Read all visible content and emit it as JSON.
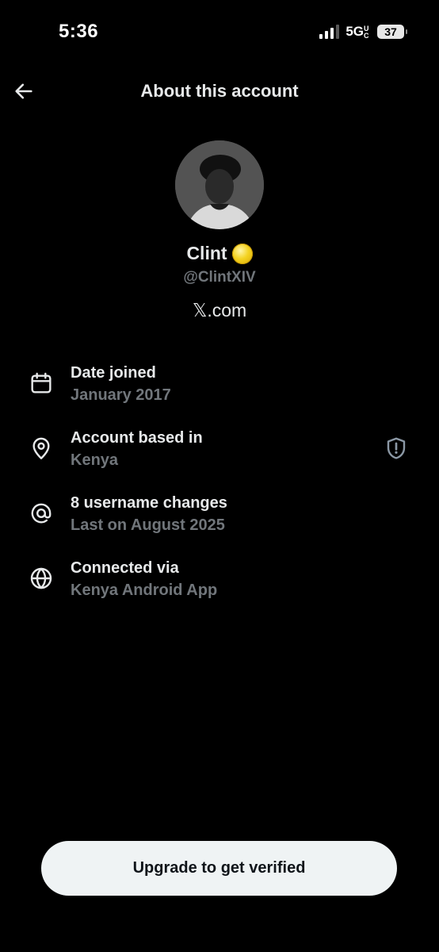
{
  "status_bar": {
    "time": "5:36",
    "network": "5G",
    "network_suffix": "UC",
    "battery": "37"
  },
  "header": {
    "title": "About this account"
  },
  "profile": {
    "name": "Clint",
    "handle": "@ClintXIV",
    "platform": "𝕏.com"
  },
  "info": {
    "date_joined": {
      "title": "Date joined",
      "value": "January 2017",
      "icon": "calendar-icon"
    },
    "location": {
      "title": "Account based in",
      "value": "Kenya",
      "icon": "location-pin-icon",
      "action_icon": "shield-alert-icon"
    },
    "username": {
      "title": "8 username changes",
      "value": "Last on August 2025",
      "icon": "at-sign-icon"
    },
    "connected": {
      "title": "Connected via",
      "value": "Kenya Android App",
      "icon": "globe-icon"
    }
  },
  "cta": {
    "label": "Upgrade to get verified"
  },
  "colors": {
    "background": "#000000",
    "primary_text": "#e7e9ea",
    "secondary_text": "#71767b",
    "button_bg": "#eff3f4"
  }
}
